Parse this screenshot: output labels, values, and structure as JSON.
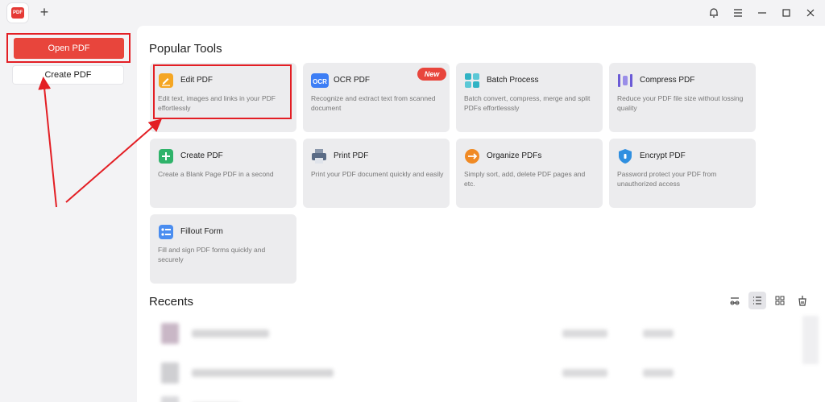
{
  "titlebar": {
    "logo_text": "PDF",
    "add_tab_glyph": "+",
    "icons": [
      "bell-icon",
      "menu-icon",
      "minimize-icon",
      "maximize-icon",
      "close-icon"
    ]
  },
  "sidebar": {
    "open_label": "Open PDF",
    "create_label": "Create PDF"
  },
  "main": {
    "popular_title": "Popular Tools",
    "recents_title": "Recents",
    "new_badge": "New",
    "tools": [
      {
        "name": "Edit PDF",
        "desc": "Edit text, images and links in your PDF effortlessly",
        "icon": "edit-icon",
        "color": "#f5a623"
      },
      {
        "name": "OCR PDF",
        "desc": "Recognize and extract text from scanned document",
        "icon": "ocr-icon",
        "color": "#3d7ef5"
      },
      {
        "name": "Batch Process",
        "desc": "Batch convert, compress, merge and split PDFs effortlesssly",
        "icon": "batch-icon",
        "color": "#31b3c4"
      },
      {
        "name": "Compress PDF",
        "desc": "Reduce your PDF file size without lossing quality",
        "icon": "compress-icon",
        "color": "#6b5bd6"
      },
      {
        "name": "Create PDF",
        "desc": "Create a Blank Page PDF in a second",
        "icon": "create-icon",
        "color": "#2fb36a"
      },
      {
        "name": "Print PDF",
        "desc": "Print your PDF document quickly and easily",
        "icon": "print-icon",
        "color": "#5a6b85"
      },
      {
        "name": "Organize PDFs",
        "desc": "Simply sort, add, delete PDF pages and etc.",
        "icon": "organize-icon",
        "color": "#f08a24"
      },
      {
        "name": "Encrypt PDF",
        "desc": "Password protect your PDF from unauthorized access",
        "icon": "encrypt-icon",
        "color": "#2f8fe0"
      },
      {
        "name": "Fillout Form",
        "desc": "Fill and sign PDF forms quickly and securely",
        "icon": "form-icon",
        "color": "#4a8df0"
      }
    ],
    "view_icons": [
      "compare-view-icon",
      "list-view-icon",
      "grid-view-icon",
      "clean-icon"
    ]
  },
  "colors": {
    "accent": "#e8453c",
    "annotation": "#e31e24"
  }
}
